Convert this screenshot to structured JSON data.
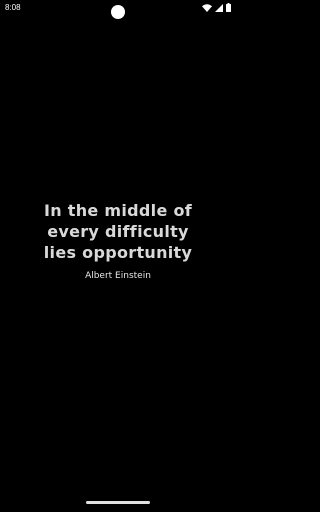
{
  "status_bar": {
    "time": "8:08",
    "icons": [
      "wifi-icon",
      "signal-icon",
      "battery-icon"
    ]
  },
  "quote": {
    "text": "In the middle of\nevery difficulty\nlies opportunity",
    "author": "Albert Einstein"
  },
  "colors": {
    "background": "#000000",
    "quote_text": "#d9d9d9",
    "author_text": "#e6e6e6"
  }
}
